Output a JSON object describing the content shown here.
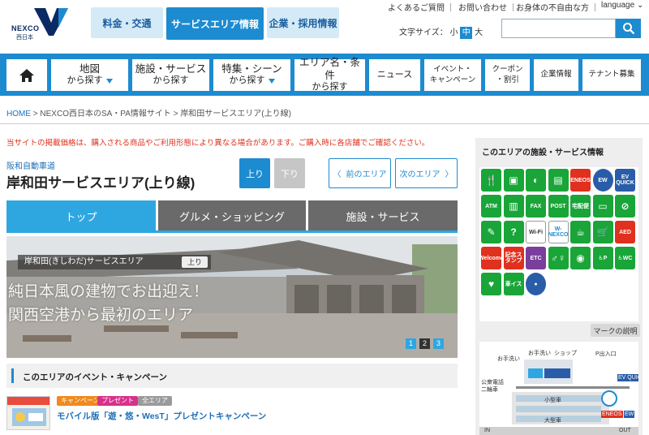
{
  "header": {
    "logo_text": "NEXCO",
    "logo_sub": "西日本",
    "global_tabs": [
      "料金・交通",
      "サービスエリア情報",
      "企業・採用情報"
    ],
    "util_links": [
      "よくあるご質問",
      "お問い合わせ",
      "お身体の不自由な方",
      "language"
    ],
    "font_size_label": "文字サイズ：",
    "font_small": "小",
    "font_mid": "中",
    "font_large": "大",
    "search_placeholder": ""
  },
  "nav": {
    "items": [
      {
        "line1": "地図",
        "line2": "から探す"
      },
      {
        "line1": "施設・サービス",
        "line2": "から探す"
      },
      {
        "line1": "特集・シーン",
        "line2": "から探す"
      },
      {
        "line1": "エリア名・条件",
        "line2": "から探す"
      },
      {
        "line1": "ニュース"
      },
      {
        "line1": "イベント・",
        "line2": "キャンペーン"
      },
      {
        "line1": "クーポン",
        "line2": "・割引"
      },
      {
        "line1": "企業情報"
      },
      {
        "line1": "テナント募集"
      }
    ]
  },
  "breadcrumb": {
    "home": "HOME",
    "sep": ">",
    "level1": "NEXCO西日本のSA・PA情報サイト",
    "current": "岸和田サービスエリア(上り線)"
  },
  "notice": "当サイトの掲載価格は、購入される商品やご利用形態により異なる場合があります。ご購入時に各店舗でご確認ください。",
  "area": {
    "road": "阪和自動車道",
    "title": "岸和田サービスエリア(上り線)",
    "up_label": "上り",
    "down_label": "下り",
    "prev_label": "前のエリア",
    "next_label": "次のエリア"
  },
  "tabs": [
    "トップ",
    "グルメ・ショッピング",
    "施設・サービス"
  ],
  "hero": {
    "label": "岸和田(きしわだ)サービスエリア",
    "badge": "上り",
    "caption1": "純日本風の建物でお出迎え！",
    "caption2": "関西空港から最初のエリア",
    "pages": [
      "1",
      "2",
      "3"
    ]
  },
  "events": {
    "heading": "このエリアのイベント・キャンペーン",
    "tags": [
      "キャンペーン",
      "プレゼント",
      "全エリア"
    ],
    "link": "モバイル版「遊・悠・WesT」プレゼントキャンペーン"
  },
  "sidebar": {
    "heading": "このエリアの施設・サービス情報",
    "legend_label": "マークの説明",
    "icons": [
      "restaurant-icon",
      "food-court-icon",
      "bread-icon",
      "shop-icon",
      "eneos-icon",
      "ev-icon",
      "ev-quick-icon",
      "atm-icon",
      "beer-icon",
      "fax-icon",
      "post-icon",
      "takkyubin-icon",
      "card-icon",
      "no-smoking-icon",
      "pen-icon",
      "info-icon",
      "wifi-icon",
      "nexco-phone-icon",
      "coffee-icon",
      "cart-icon",
      "aed-icon",
      "welcome-icon",
      "stamp-icon",
      "etc-icon",
      "toilet-icon",
      "baby-icon",
      "wheelchair-p-icon",
      "wheelchair-wc-icon",
      "nursing-icon",
      "wheelchair-car-icon",
      "dog-icon"
    ],
    "icon_labels": {
      "eneos": "ENEOS",
      "ev": "EW",
      "evquick": "EV QUICK",
      "atm": "ATM",
      "fax": "FAX",
      "post": "POST",
      "takkyu": "宅配便",
      "aed": "AED",
      "welcome": "Welcome",
      "stamp": "記念スタンプ",
      "etc": "ETC",
      "wifi": "Wi-Fi",
      "nexcotel": "W-NEXCO",
      "chair": "車イス",
      "wc": "WC",
      "p": "P"
    }
  },
  "map": {
    "labels": [
      "お手洗い",
      "ショップ",
      "お手洗い",
      "P出入口",
      "公衆電話",
      "二輪車",
      "小型車",
      "大型車",
      "IN",
      "OUT"
    ],
    "legend_bits": [
      "EV QUICK",
      "ENEOS",
      "EW"
    ]
  },
  "colors": {
    "primary": "#1d8bd0",
    "green": "#19a538",
    "red": "#e0301e"
  }
}
